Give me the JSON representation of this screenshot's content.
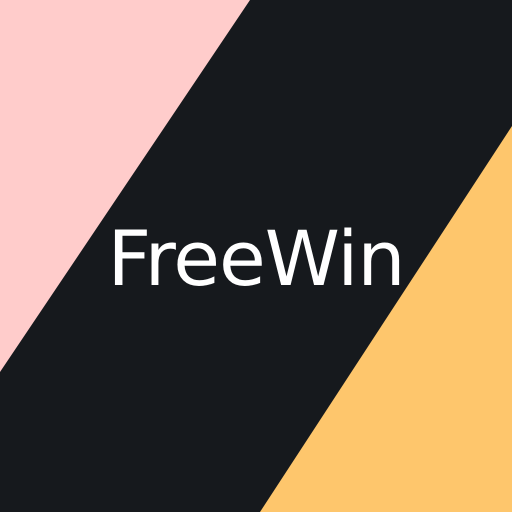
{
  "title": "FreeWin",
  "colors": {
    "left_band": "#ffcccb",
    "center_band": "#16191d",
    "right_band": "#fec66c",
    "title_text": "#ffffff"
  }
}
